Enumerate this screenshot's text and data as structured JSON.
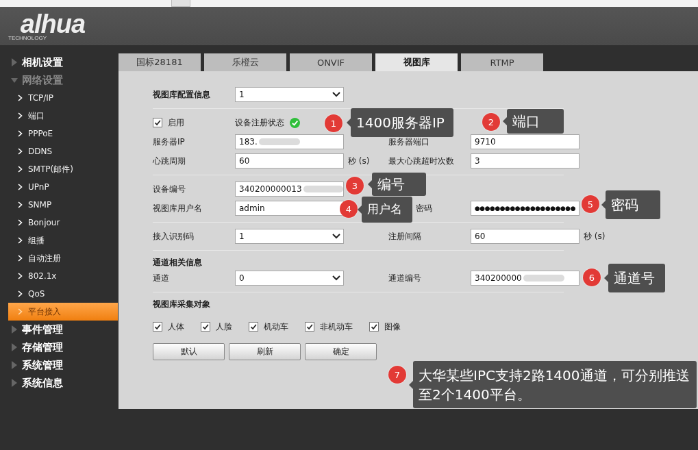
{
  "header": {
    "logo": "alhua",
    "logo_sub": "TECHNOLOGY"
  },
  "sidebar": {
    "items": [
      {
        "label": "相机设置",
        "expanded": false
      },
      {
        "label": "网络设置",
        "expanded": true,
        "children": [
          {
            "label": "TCP/IP",
            "selected": false
          },
          {
            "label": "端口",
            "selected": false
          },
          {
            "label": "PPPoE",
            "selected": false
          },
          {
            "label": "DDNS",
            "selected": false
          },
          {
            "label": "SMTP(邮件)",
            "selected": false
          },
          {
            "label": "UPnP",
            "selected": false
          },
          {
            "label": "SNMP",
            "selected": false
          },
          {
            "label": "Bonjour",
            "selected": false
          },
          {
            "label": "组播",
            "selected": false
          },
          {
            "label": "自动注册",
            "selected": false
          },
          {
            "label": "802.1x",
            "selected": false
          },
          {
            "label": "QoS",
            "selected": false
          },
          {
            "label": "平台接入",
            "selected": true
          }
        ]
      },
      {
        "label": "事件管理",
        "expanded": false
      },
      {
        "label": "存储管理",
        "expanded": false
      },
      {
        "label": "系统管理",
        "expanded": false
      },
      {
        "label": "系统信息",
        "expanded": false
      }
    ]
  },
  "tabs": [
    {
      "label": "国标28181",
      "selected": false
    },
    {
      "label": "乐橙云",
      "selected": false
    },
    {
      "label": "ONVIF",
      "selected": false
    },
    {
      "label": "视图库",
      "selected": true
    },
    {
      "label": "RTMP",
      "selected": false
    }
  ],
  "groups": [
    {
      "rows": [
        {
          "kind": "field",
          "label": "视图库配置信息",
          "bold": true,
          "field": {
            "kind": "select",
            "value": "1"
          }
        }
      ]
    },
    {
      "rows": [
        {
          "kind": "enable",
          "checkbox": {
            "label": "启用",
            "checked": true
          },
          "status": {
            "label": "设备注册状态",
            "ok": true
          }
        },
        {
          "kind": "field",
          "label": "服务器IP",
          "bold": false,
          "field": {
            "kind": "text",
            "value": "183.",
            "redacted": true
          },
          "label2": "服务器端口",
          "field2": {
            "kind": "text",
            "value": "9710",
            "redacted": false
          }
        },
        {
          "kind": "field",
          "label": "心跳周期",
          "bold": false,
          "field": {
            "kind": "text",
            "value": "60",
            "redacted": false
          },
          "unit": "秒 (s)",
          "label2": "最大心跳超时次数",
          "field2": {
            "kind": "text",
            "value": "3",
            "redacted": false
          }
        }
      ]
    },
    {
      "rows": [
        {
          "kind": "field",
          "label": "设备编号",
          "bold": false,
          "field": {
            "kind": "text",
            "value": "340200000013",
            "redacted": true
          }
        },
        {
          "kind": "field",
          "label": "视图库用户名",
          "bold": false,
          "field": {
            "kind": "text",
            "value": "admin",
            "redacted": false
          },
          "label2": "密码",
          "field2": {
            "kind": "password",
            "value": "●●●●●●●●●●●●●●●●●●●●"
          }
        }
      ]
    },
    {
      "rows": [
        {
          "kind": "field",
          "label": "接入识别码",
          "bold": false,
          "field": {
            "kind": "select",
            "value": "1"
          },
          "label2": "注册间隔",
          "field2": {
            "kind": "text",
            "value": "60",
            "redacted": false
          },
          "unit2": "秒 (s)"
        }
      ]
    },
    {
      "heading": "通道相关信息",
      "rows": [
        {
          "kind": "field",
          "label": "通道",
          "bold": false,
          "field": {
            "kind": "select",
            "value": "0"
          },
          "label2": "通道编号",
          "field2": {
            "kind": "text",
            "value": "340200000",
            "redacted": true
          }
        }
      ]
    }
  ],
  "objects": {
    "heading": "视图库采集对象",
    "items": [
      {
        "label": "人体",
        "checked": true
      },
      {
        "label": "人脸",
        "checked": true
      },
      {
        "label": "机动车",
        "checked": true
      },
      {
        "label": "非机动车",
        "checked": true
      },
      {
        "label": "图像",
        "checked": true
      }
    ]
  },
  "buttons": [
    "默认",
    "刷新",
    "确定"
  ],
  "annotations": [
    {
      "number": "1",
      "text": "1400服务器IP"
    },
    {
      "number": "2",
      "text": "端口"
    },
    {
      "number": "3",
      "text": "编号"
    },
    {
      "number": "4",
      "text": "用户名"
    },
    {
      "number": "5",
      "text": "密码"
    },
    {
      "number": "6",
      "text": "通道号"
    },
    {
      "number": "7",
      "text": "大华某些IPC支持2路1400通道，可分别推送至2个1400平台。"
    }
  ]
}
